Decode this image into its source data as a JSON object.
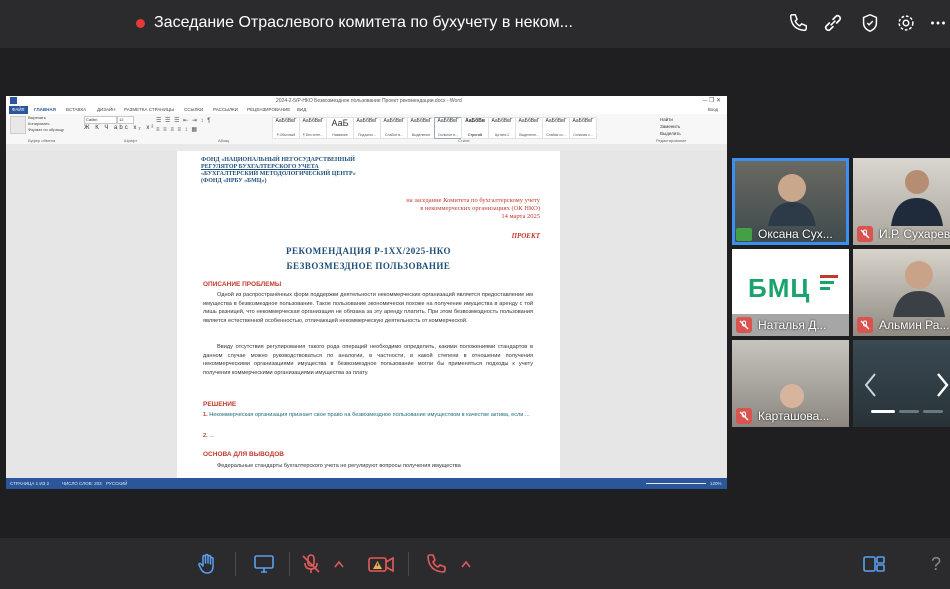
{
  "meeting": {
    "title": "Заседание Отраслевого комитета по бухучету в неком..."
  },
  "word": {
    "window_title": "2024-2-5/Р-НКО Безвозмездное пользование Проект рекомендации.docx - Word",
    "tabs": [
      "ФАЙЛ",
      "ГЛАВНАЯ",
      "ВСТАВКА",
      "ДИЗАЙН",
      "РАЗМЕТКА СТРАНИЦЫ",
      "ССЫЛКИ",
      "РАССЫЛКИ",
      "РЕЦЕНЗИРОВАНИЕ",
      "ВИД"
    ],
    "user": "Вход",
    "font_name": "Calibri",
    "font_size": "12",
    "clipboard": [
      "Вырезать",
      "Копировать",
      "Формат по образцу"
    ],
    "groups": [
      "Буфер обмена",
      "Шрифт",
      "Абзац",
      "Стили",
      "Редактирование"
    ],
    "styles": [
      {
        "sample": "АаБбВвГ",
        "name": "¶ Обычный"
      },
      {
        "sample": "АаБбВвГ",
        "name": "¶ Без инте..."
      },
      {
        "sample": "АаБ",
        "name": "Название"
      },
      {
        "sample": "АаБбВвГ",
        "name": "Подзагол..."
      },
      {
        "sample": "АаБбВвГ",
        "name": "Слабое в..."
      },
      {
        "sample": "АаБбВвГ",
        "name": "Выделение"
      },
      {
        "sample": "АаБбВвГ",
        "name": "Сильное в..."
      },
      {
        "sample": "АаБбВв",
        "name": "Строгий"
      },
      {
        "sample": "АаБбВвГ",
        "name": "Цитата 2"
      },
      {
        "sample": "АаБбВвГ",
        "name": "Выделенн..."
      },
      {
        "sample": "АаБбВвГ",
        "name": "Слабая сс..."
      },
      {
        "sample": "АаБбВвГ",
        "name": "Сильная с..."
      }
    ],
    "editing": [
      "Найти",
      "Заменить",
      "Выделить"
    ],
    "status": {
      "page": "СТРАНИЦА 1 ИЗ 2",
      "words": "ЧИСЛО СЛОВ: 203",
      "lang": "РУССКИЙ",
      "zoom": "120%"
    },
    "document": {
      "org_lines": [
        "ФОНД «НАЦИОНАЛЬНЫЙ НЕГОСУДАРСТВЕННЫЙ",
        "РЕГУЛЯТОР БУХГАЛТЕРСКОГО УЧЕТА",
        "«БУХГАЛТЕРСКИЙ МЕТОДОЛОГИЧЕСКИЙ ЦЕНТР»",
        "(ФОНД «НРБУ «БМЦ»)"
      ],
      "addressee": [
        "на заседание Комитета по бухгалтерскому учету",
        "в некоммерческих организациях (ОК НКО)",
        "14 марта 2025"
      ],
      "draft_label": "ПРОЕКТ",
      "title1": "РЕКОМЕНДАЦИЯ Р-1ХХ/2025-НКО",
      "title2": "БЕЗВОЗМЕЗДНОЕ ПОЛЬЗОВАНИЕ",
      "section1": "ОПИСАНИЕ ПРОБЛЕМЫ",
      "para1": "Одной из распространённых форм поддержки деятельности некоммерческих организаций является предоставление им имущества в безвозмездное пользование. Такое пользование экономически похоже на получение имущества в аренду с той лишь разницей, что некоммерческая организация не обязана за эту аренду платить. При этом безвозмездность пользования является естественной особенностью, отличающей некоммерческую деятельность от коммерческой.",
      "para2": "Ввиду отсутствия регулирования такого рода операций необходимо определить, какими положениями стандартов в данном случае можно руководствоваться по аналогии, в частности, в какой степени в отношении получения некоммерческими организациями имущества в безвозмездное пользование могли бы применяться подходы к учету получения коммерческими организациями имущества за плату.",
      "section2": "РЕШЕНИЕ",
      "item1_num": "1.",
      "item1": "Некоммерческая организация признает свое право на безвозмездное пользование имуществом в качестве актива, если ...",
      "item2_num": "2.",
      "item2": "...",
      "section3": "ОСНОВА ДЛЯ ВЫВОДОВ",
      "para3": "Федеральные стандарты бухгалтерского учета не регулируют вопросы получения имущества"
    }
  },
  "participants": [
    {
      "name": "Оксана Сух...",
      "status": "screen-share",
      "has_video": true
    },
    {
      "name": "И.Р. Сухарев",
      "status": "muted",
      "has_video": true
    },
    {
      "name": "Наталья Д...",
      "status": "muted",
      "has_video": false,
      "logo_text": "БМЦ"
    },
    {
      "name": "Альмин Ра...",
      "status": "muted",
      "has_video": true
    },
    {
      "name": "Карташова...",
      "status": "muted",
      "has_video": true
    }
  ],
  "colors": {
    "accent": "#4a90e2",
    "danger": "#d9534f",
    "word_blue": "#2b579a",
    "active_speaker": "#3b8ff0",
    "bmc_green": "#1aa36c"
  }
}
